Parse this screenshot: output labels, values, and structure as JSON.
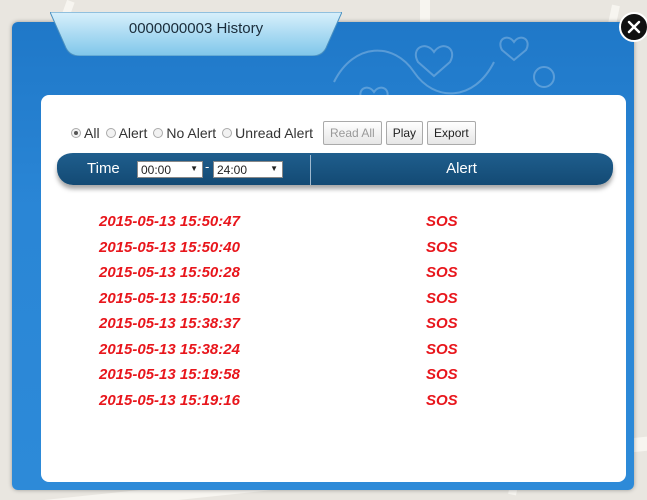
{
  "window": {
    "title": "0000000003 History"
  },
  "filters": {
    "options": [
      {
        "label": "All",
        "checked": true
      },
      {
        "label": "Alert",
        "checked": false
      },
      {
        "label": "No Alert",
        "checked": false
      },
      {
        "label": "Unread Alert",
        "checked": false
      }
    ],
    "read_all_label": "Read All",
    "play_label": "Play",
    "export_label": "Export"
  },
  "table": {
    "time_header": "Time",
    "time_from": "00:00",
    "time_to": "24:00",
    "alert_header": "Alert",
    "rows": [
      {
        "time": "2015-05-13 15:50:47",
        "alert": "SOS"
      },
      {
        "time": "2015-05-13 15:50:40",
        "alert": "SOS"
      },
      {
        "time": "2015-05-13 15:50:28",
        "alert": "SOS"
      },
      {
        "time": "2015-05-13 15:50:16",
        "alert": "SOS"
      },
      {
        "time": "2015-05-13 15:38:37",
        "alert": "SOS"
      },
      {
        "time": "2015-05-13 15:38:24",
        "alert": "SOS"
      },
      {
        "time": "2015-05-13 15:19:58",
        "alert": "SOS"
      },
      {
        "time": "2015-05-13 15:19:16",
        "alert": "SOS"
      }
    ]
  },
  "colors": {
    "alert_text": "#e8161c",
    "window_blue": "#2a86d6",
    "header_bar": "#134a74"
  },
  "icons": {
    "close": "close-icon",
    "dropdown": "chevron-down-icon"
  }
}
